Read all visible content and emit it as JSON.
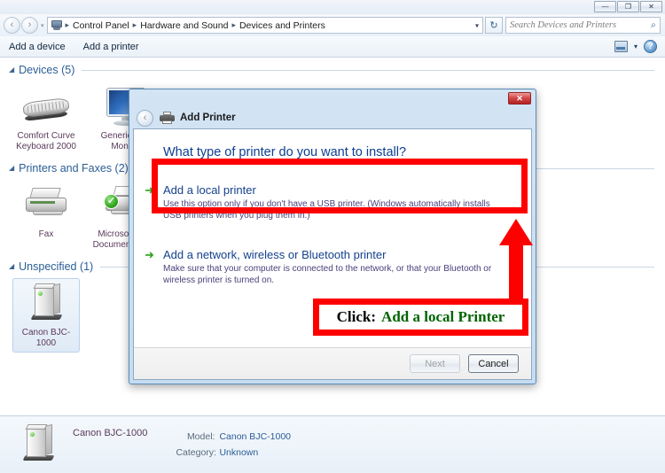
{
  "window": {
    "controls": {
      "minimize": "—",
      "restore": "❐",
      "close": "✕"
    }
  },
  "address_bar": {
    "back_icon": "‹",
    "forward_icon": "›",
    "history_caret": "▾",
    "computer_icon": "computer-icon",
    "breadcrumbs": [
      "Control Panel",
      "Hardware and Sound",
      "Devices and Printers"
    ],
    "separator": "▸",
    "dropdown_caret": "▾",
    "refresh_icon": "↻",
    "search": {
      "placeholder": "Search Devices and Printers",
      "icon": "search-icon"
    }
  },
  "command_bar": {
    "add_device": "Add a device",
    "add_printer": "Add a printer",
    "view_caret": "▾",
    "help_label": "?"
  },
  "groups": [
    {
      "triangle": "◢",
      "label": "Devices (5)",
      "items": [
        {
          "name": "Comfort Curve Keyboard 2000",
          "icon": "keyboard-icon",
          "selected": false
        },
        {
          "name": "Generic PnP Monitor",
          "icon": "monitor-icon",
          "selected": false
        }
      ]
    },
    {
      "triangle": "◢",
      "label": "Printers and Faxes (2)",
      "items": [
        {
          "name": "Fax",
          "icon": "fax-icon",
          "selected": false
        },
        {
          "name": "Microsoft XPS Document Writer",
          "icon": "printer-icon",
          "selected": false,
          "badge": "✓"
        }
      ]
    },
    {
      "triangle": "◢",
      "label": "Unspecified (1)",
      "items": [
        {
          "name": "Canon BJC-1000",
          "icon": "tower-icon",
          "selected": true
        }
      ]
    }
  ],
  "details_pane": {
    "title": "Canon BJC-1000",
    "rows": [
      {
        "key": "Model:",
        "value": "Canon BJC-1000"
      },
      {
        "key": "Category:",
        "value": "Unknown"
      }
    ]
  },
  "dialog": {
    "title": "Add Printer",
    "back_icon": "‹",
    "close_label": "✕",
    "heading": "What type of printer do you want to install?",
    "options": [
      {
        "arrow": "➜",
        "title": "Add a local printer",
        "description": "Use this option only if you don't have a USB printer. (Windows automatically installs USB printers when you plug them in.)"
      },
      {
        "arrow": "➜",
        "title": "Add a network, wireless or Bluetooth printer",
        "description": "Make sure that your computer is connected to the network, or that your Bluetooth or wireless printer is turned on."
      }
    ],
    "buttons": {
      "next": "Next",
      "next_disabled": true,
      "cancel": "Cancel"
    }
  },
  "annotation": {
    "click_label": "Click:",
    "target_label": "Add a local Printer",
    "box_color": "#fe0000",
    "target_color": "#006400",
    "arrow_color": "#fe0000"
  }
}
